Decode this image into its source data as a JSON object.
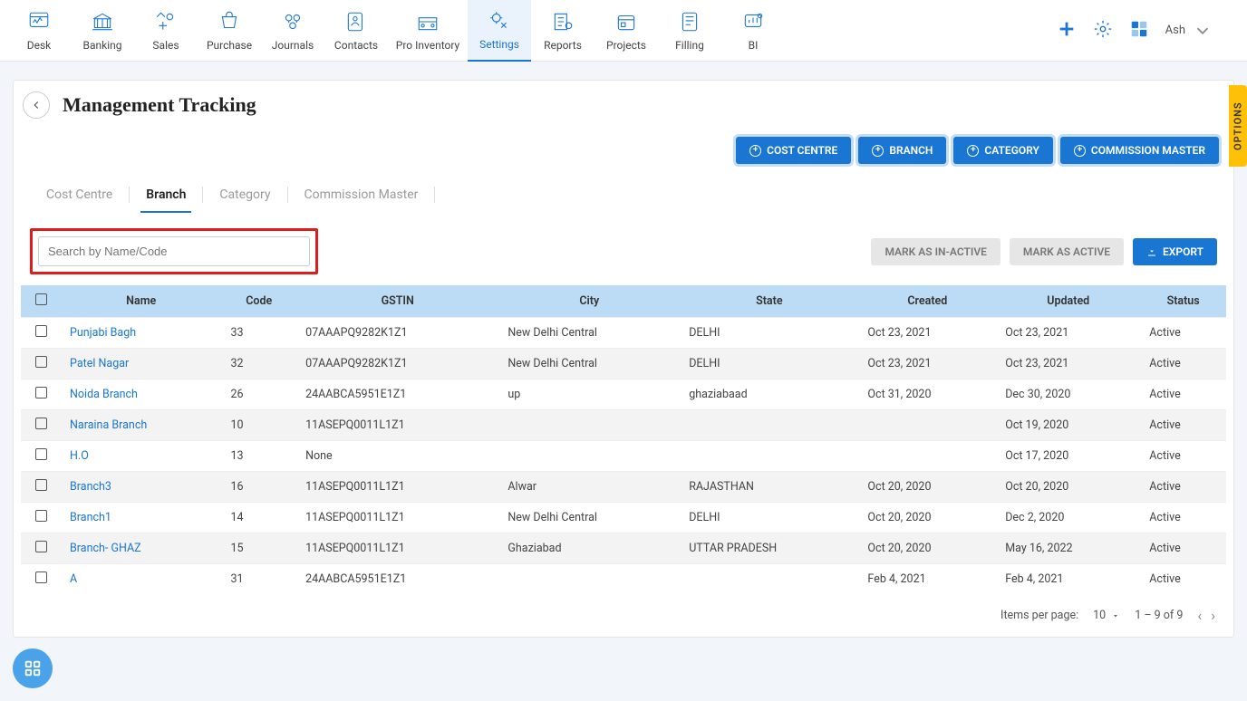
{
  "nav": {
    "items": [
      {
        "label": "Desk"
      },
      {
        "label": "Banking"
      },
      {
        "label": "Sales"
      },
      {
        "label": "Purchase"
      },
      {
        "label": "Journals"
      },
      {
        "label": "Contacts"
      },
      {
        "label": "Pro Inventory"
      },
      {
        "label": "Settings"
      },
      {
        "label": "Reports"
      },
      {
        "label": "Projects"
      },
      {
        "label": "Filling"
      },
      {
        "label": "BI"
      }
    ],
    "user": "Ash"
  },
  "page": {
    "title": "Management Tracking"
  },
  "buttons": {
    "cost_centre": "COST CENTRE",
    "branch": "BRANCH",
    "category": "CATEGORY",
    "commission_master": "COMMISSION MASTER",
    "mark_inactive": "MARK AS IN-ACTIVE",
    "mark_active": "MARK AS ACTIVE",
    "export": "EXPORT"
  },
  "tabs": {
    "cost_centre": "Cost Centre",
    "branch": "Branch",
    "category": "Category",
    "commission_master": "Commission Master"
  },
  "search": {
    "placeholder": "Search by Name/Code"
  },
  "table": {
    "headers": {
      "name": "Name",
      "code": "Code",
      "gstin": "GSTIN",
      "city": "City",
      "state": "State",
      "created": "Created",
      "updated": "Updated",
      "status": "Status"
    },
    "rows": [
      {
        "name": "Punjabi Bagh",
        "code": "33",
        "gstin": "07AAAPQ9282K1Z1",
        "city": "New Delhi Central",
        "state": "DELHI",
        "created": "Oct 23, 2021",
        "updated": "Oct 23, 2021",
        "status": "Active"
      },
      {
        "name": "Patel Nagar",
        "code": "32",
        "gstin": "07AAAPQ9282K1Z1",
        "city": "New Delhi Central",
        "state": "DELHI",
        "created": "Oct 23, 2021",
        "updated": "Oct 23, 2021",
        "status": "Active"
      },
      {
        "name": "Noida Branch",
        "code": "26",
        "gstin": "24AABCA5951E1Z1",
        "city": "up",
        "state": "ghaziabaad",
        "created": "Oct 31, 2020",
        "updated": "Dec 30, 2020",
        "status": "Active"
      },
      {
        "name": "Naraina Branch",
        "code": "10",
        "gstin": "11ASEPQ0011L1Z1",
        "city": "",
        "state": "",
        "created": "",
        "updated": "Oct 19, 2020",
        "status": "Active"
      },
      {
        "name": "H.O",
        "code": "13",
        "gstin": "None",
        "city": "",
        "state": "",
        "created": "",
        "updated": "Oct 17, 2020",
        "status": "Active"
      },
      {
        "name": "Branch3",
        "code": "16",
        "gstin": "11ASEPQ0011L1Z1",
        "city": "Alwar",
        "state": "RAJASTHAN",
        "created": "Oct 20, 2020",
        "updated": "Oct 20, 2020",
        "status": "Active"
      },
      {
        "name": "Branch1",
        "code": "14",
        "gstin": "11ASEPQ0011L1Z1",
        "city": "New Delhi Central",
        "state": "DELHI",
        "created": "Oct 20, 2020",
        "updated": "Dec 2, 2020",
        "status": "Active"
      },
      {
        "name": "Branch- GHAZ",
        "code": "15",
        "gstin": "11ASEPQ0011L1Z1",
        "city": "Ghaziabad",
        "state": "UTTAR PRADESH",
        "created": "Oct 20, 2020",
        "updated": "May 16, 2022",
        "status": "Active"
      },
      {
        "name": "A",
        "code": "31",
        "gstin": "24AABCA5951E1Z1",
        "city": "",
        "state": "",
        "created": "Feb 4, 2021",
        "updated": "Feb 4, 2021",
        "status": "Active"
      }
    ]
  },
  "pager": {
    "label": "Items per page:",
    "per_page": "10",
    "range": "1 – 9 of 9"
  },
  "options_tab": "OPTIONS"
}
